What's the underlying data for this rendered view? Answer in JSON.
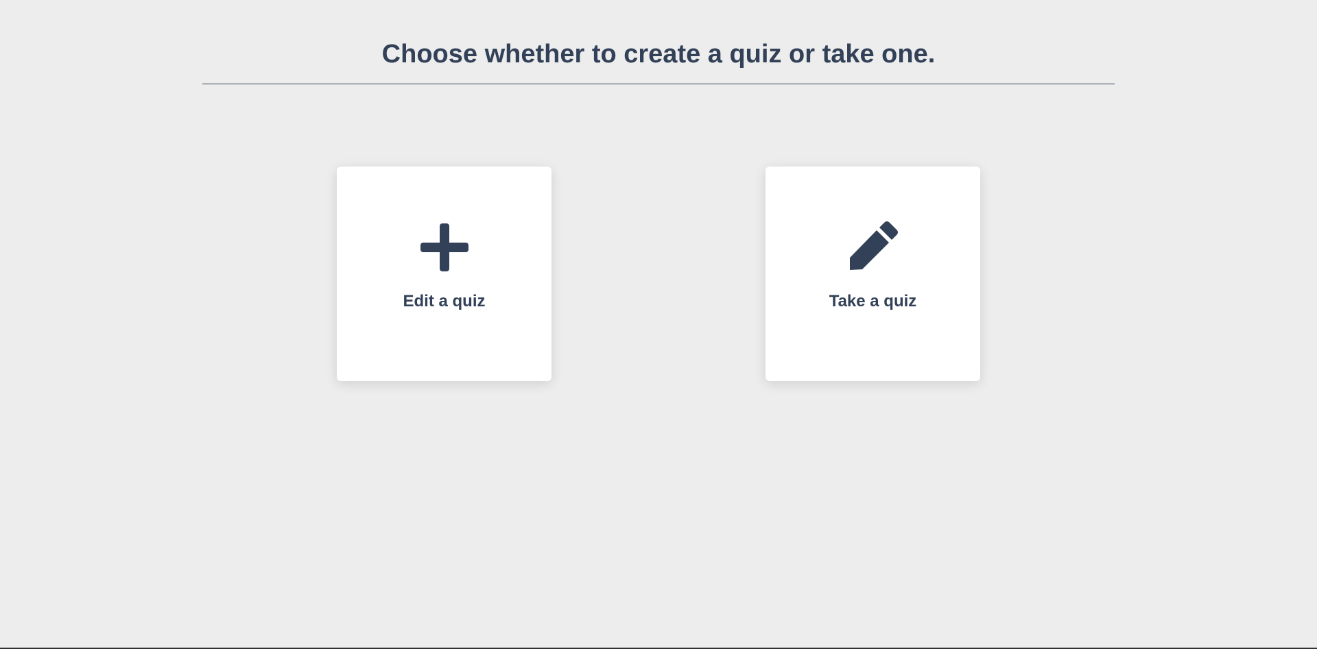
{
  "header": {
    "title": "Choose whether to create a quiz or take one."
  },
  "cards": [
    {
      "label": "Edit a quiz",
      "icon": "plus-icon"
    },
    {
      "label": "Take a quiz",
      "icon": "pencil-icon"
    }
  ],
  "colors": {
    "background": "#ededed",
    "text": "#324157",
    "card": "#ffffff"
  }
}
